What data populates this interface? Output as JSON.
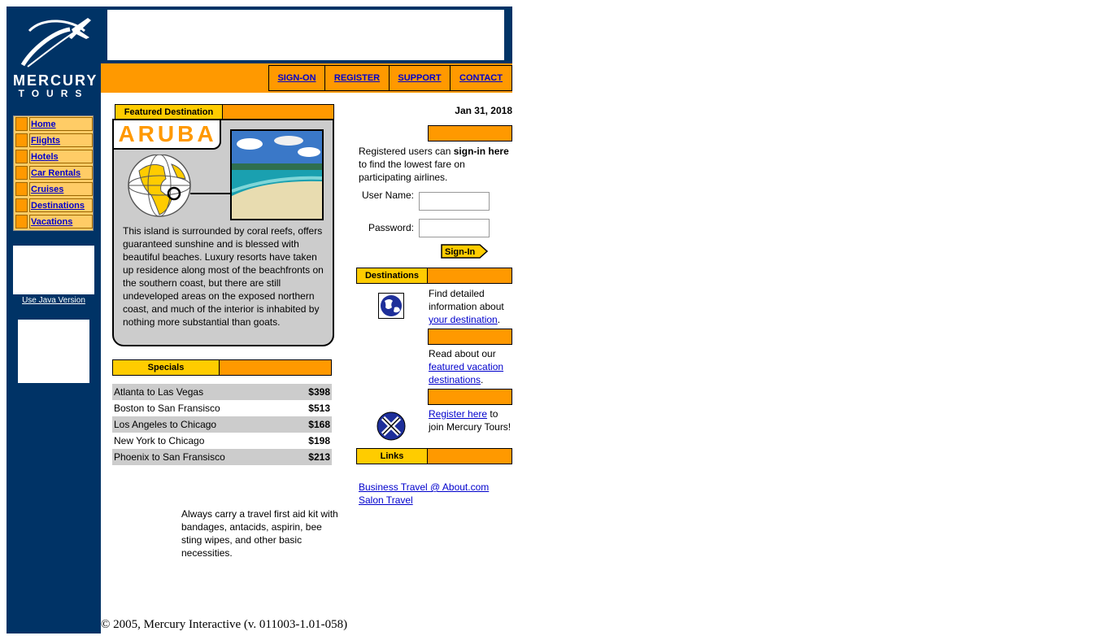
{
  "brand": {
    "line1": "MERCURY",
    "line2": "TOURS"
  },
  "topnav": [
    {
      "label": "SIGN-ON"
    },
    {
      "label": "REGISTER"
    },
    {
      "label": "SUPPORT"
    },
    {
      "label": "CONTACT"
    }
  ],
  "menu": [
    {
      "label": "Home"
    },
    {
      "label": "Flights"
    },
    {
      "label": "Hotels"
    },
    {
      "label": "Car Rentals"
    },
    {
      "label": "Cruises"
    },
    {
      "label": "Destinations"
    },
    {
      "label": "Vacations"
    }
  ],
  "java_link": "Use Java Version",
  "featured": {
    "header": "Featured Destination",
    "name": "ARUBA",
    "description": "This island is surrounded by coral reefs, offers guaranteed sunshine and is blessed with beautiful beaches. Luxury resorts have taken up residence along most of the beachfronts on the southern coast, but there are still undeveloped areas on the exposed northern coast, and much of the interior is inhabited by nothing more substantial than goats."
  },
  "specials": {
    "header": "Specials",
    "rows": [
      {
        "route": "Atlanta to Las Vegas",
        "price": "$398"
      },
      {
        "route": "Boston to San Fransisco",
        "price": "$513"
      },
      {
        "route": "Los Angeles to Chicago",
        "price": "$168"
      },
      {
        "route": "New York to Chicago",
        "price": "$198"
      },
      {
        "route": "Phoenix to San Fransisco",
        "price": "$213"
      }
    ]
  },
  "tip": "Always carry a travel first aid kit with bandages, antacids, aspirin, bee sting wipes, and other basic necessities.",
  "footer": "© 2005, Mercury Interactive (v. 011003-1.01-058)",
  "date": "Jan 31, 2018",
  "signin": {
    "intro_pre": "Registered users can ",
    "intro_bold": "sign-in here",
    "intro_post": " to find the lowest fare on participating airlines.",
    "user_label": "User Name:",
    "password_label": "Password:",
    "user_value": "",
    "password_value": "",
    "button_label": "Sign-In"
  },
  "destinations": {
    "header": "Destinations",
    "text_pre": "Find detailed information about ",
    "link": "your destination",
    "text_post": "."
  },
  "vacations": {
    "text_pre": "Read about our ",
    "link": "featured vacation destinations",
    "text_post": "."
  },
  "register": {
    "link": "Register here",
    "text_post": " to join Mercury Tours!"
  },
  "links": {
    "header": "Links",
    "items": [
      {
        "label": "Business Travel @ About.com"
      },
      {
        "label": "Salon Travel"
      }
    ]
  },
  "colors": {
    "navy": "#003366",
    "orange": "#ff9900",
    "yellow": "#ffcc00",
    "light_orange": "#ffcc66",
    "link": "#0000cc"
  }
}
